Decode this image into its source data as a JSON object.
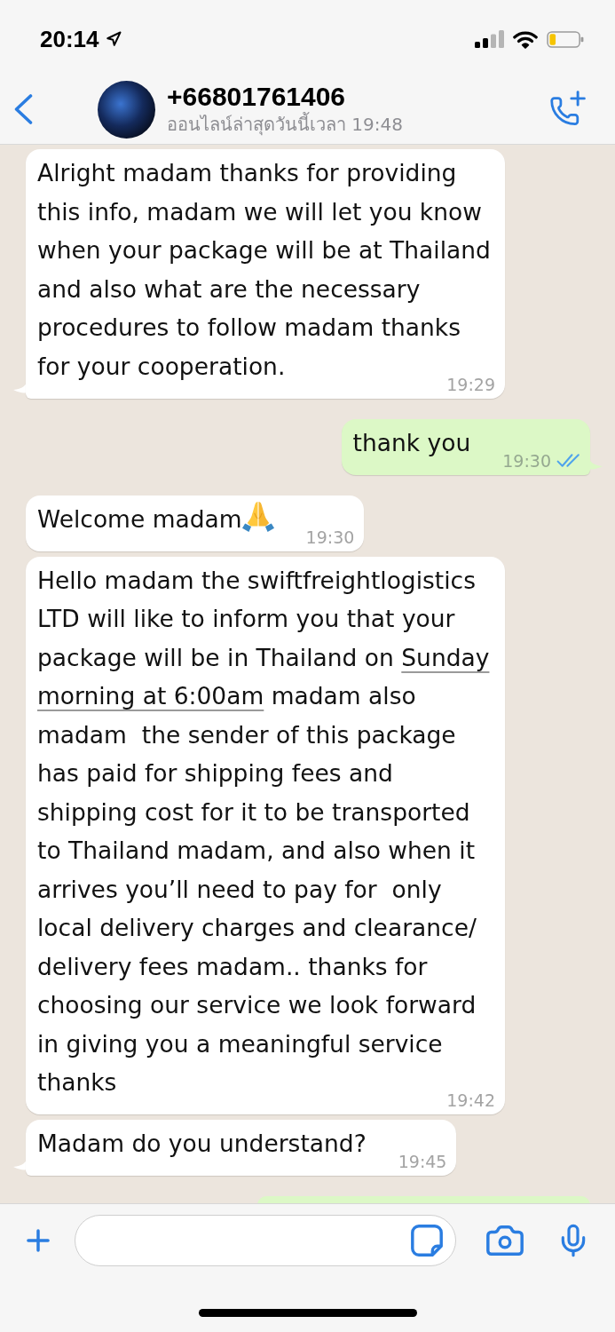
{
  "status_bar": {
    "time": "20:14"
  },
  "header": {
    "title": "+66801761406",
    "subtitle": "ออนไลน์ล่าสุดวันนี้เวลา 19:48"
  },
  "messages": [
    {
      "kind": "incoming",
      "tail": true,
      "text": "Alright madam thanks for providing this info, madam we will let you know when your package will be at Thailand and also what are the necessary procedures to follow madam thanks for your cooperation.",
      "time": "19:29"
    },
    {
      "kind": "outgoing",
      "tail": true,
      "text": "thank you",
      "time": "19:30",
      "read": true
    },
    {
      "kind": "incoming",
      "tail": false,
      "parts": [
        {
          "kind": "text",
          "text": "Welcome madam"
        },
        {
          "kind": "emoji"
        }
      ],
      "time": "19:30"
    },
    {
      "kind": "incoming",
      "tail": false,
      "parts": [
        {
          "kind": "text",
          "text": "Hello madam the swiftfreightlogistics LTD will like to inform you that your package will be in Thailand on "
        },
        {
          "kind": "link",
          "text": "Sunday "
        },
        {
          "kind": "link",
          "text": "morning at 6:00am"
        },
        {
          "kind": "text",
          "text": " madam also madam  the sender of this package has paid for shipping fees and shipping cost for it to be transported to Thailand madam, and also when it arrives you’ll need to pay for  only local delivery charges and clearance/delivery fees madam.. thanks for choosing our service we look forward in giving you a meaningful service thanks"
        }
      ],
      "time": "19:42"
    },
    {
      "kind": "incoming",
      "tail": true,
      "text": "Madam do you understand?",
      "time": "19:45"
    },
    {
      "kind": "outgoing"
    }
  ]
}
